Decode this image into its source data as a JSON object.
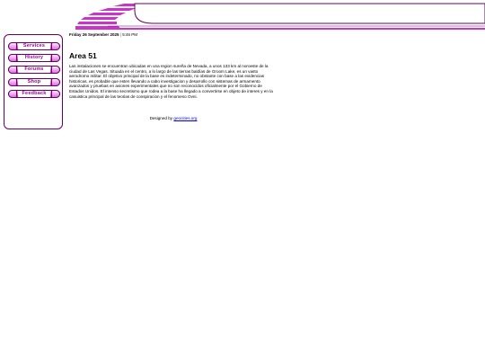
{
  "header": {
    "brand_color": "#cc33cc",
    "dark_color": "#660066"
  },
  "sidebar": {
    "items": [
      {
        "label": "Services"
      },
      {
        "label": "History"
      },
      {
        "label": "Forums"
      },
      {
        "label": "Shop"
      },
      {
        "label": "Feedback"
      }
    ]
  },
  "main": {
    "date": "Friday 26 September 2025",
    "separator": "|",
    "time": "5:46 PM",
    "title": "Area 51",
    "paragraph": "Las instalaciones se encuentran ubicadas en una region sureña de Nevada, a unos 133 km al noroeste de la ciudad de Las Vegas. Situada en el centro, a lo largo de las tierras baldías de Groom Lake, es un vasto aerodromo militar. El objetivo principal de la base es indeterminado, no obstante con base a las evidencias historicas, es probable que esten llevando a cabo investigacion y desarrollo con sistemas de armamento avanzados y pruebas en aviones experimentales que no son reconocidos oficialmente por el Gobierno de Estados Unidos. El intenso secretismo que rodea a la base ha llegado a convertirse en objeto de interes y en la casuistica principal de las teorias de conspiracion y el fenomeno Ovni.",
    "credit_prefix": "Designed by",
    "credit_link": "geocities.org"
  }
}
